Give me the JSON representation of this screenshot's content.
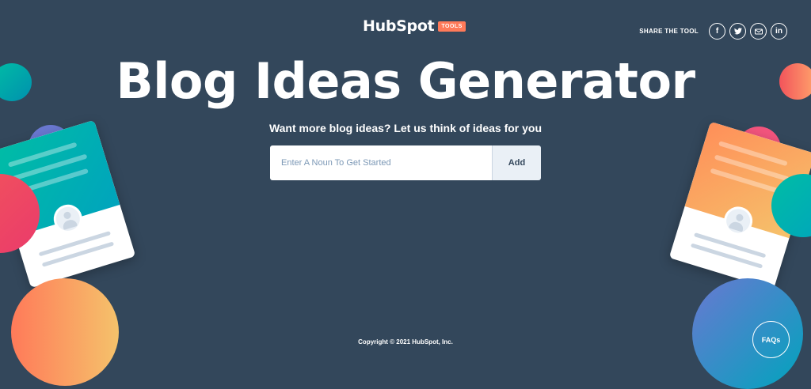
{
  "header": {
    "logo_text": "HubSpot",
    "badge": "TOOLS",
    "share_label": "SHARE THE TOOL",
    "social": [
      {
        "name": "facebook-icon",
        "glyph": "f"
      },
      {
        "name": "twitter-icon",
        "glyph": "t"
      },
      {
        "name": "email-icon",
        "glyph": "✉"
      },
      {
        "name": "linkedin-icon",
        "glyph": "in"
      }
    ]
  },
  "hero": {
    "title": "Blog Ideas Generator",
    "subtitle": "Want more blog ideas? Let us think of ideas for you"
  },
  "form": {
    "placeholder": "Enter A Noun To Get Started",
    "value": "",
    "button_label": "Add"
  },
  "footer": {
    "copyright": "Copyright © 2021 HubSpot, Inc."
  },
  "faqs_label": "FAQs",
  "colors": {
    "background": "#33475b",
    "accent": "#ff7a59",
    "teal": "#00bda5",
    "button_bg": "#eaf0f6"
  }
}
